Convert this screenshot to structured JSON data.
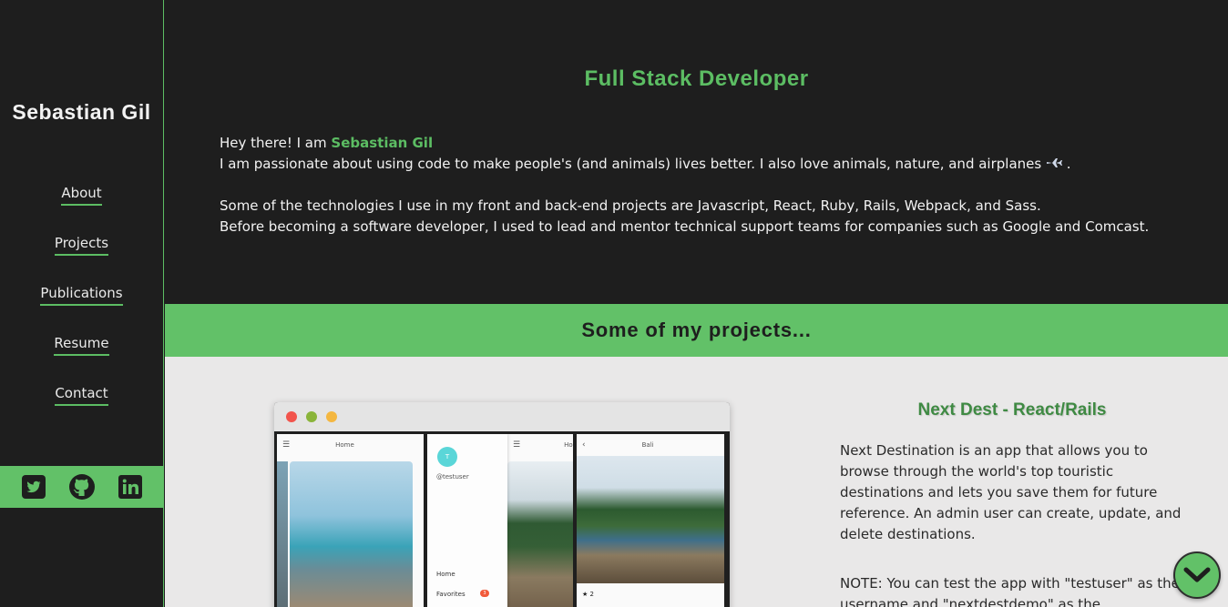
{
  "sidebar": {
    "name": "Sebastian Gil",
    "nav": [
      {
        "label": "About"
      },
      {
        "label": "Projects"
      },
      {
        "label": "Publications"
      },
      {
        "label": "Resume"
      },
      {
        "label": "Contact"
      }
    ],
    "social_icons": [
      "twitter-icon",
      "github-icon",
      "linkedin-icon"
    ]
  },
  "hero": {
    "title": "Full Stack Developer",
    "greeting_prefix": "Hey there! I am ",
    "greeting_name": "Sebastian Gil",
    "line2": "I am passionate about using code to make people's (and animals) lives better. I also love animals, nature, and airplanes",
    "line2_suffix": " .",
    "line3": "Some of the technologies I use in my front and back-end projects are Javascript, React, Ruby, Rails, Webpack, and Sass.",
    "line4": "Before becoming a software developer, I used to lead and mentor technical support teams for companies such as Google and Comcast."
  },
  "projects_section": {
    "heading": "Some of my projects...",
    "project": {
      "title": "Next Dest - React/Rails",
      "description": "Next Destination is an app that allows you to browse through the world's top touristic destinations and lets you save them for future reference. An admin user can create, update, and delete destinations.",
      "note": "NOTE: You can test the app with \"testuser\" as the username and \"nextdestdemo\" as the",
      "mockup": {
        "screen1_title": "Home",
        "screen2_avatar": "T",
        "screen2_user": "@testuser",
        "screen2_home": "Home",
        "screen2_favorites": "Favorites",
        "screen2_badge": "3",
        "screen2_title": "Ho",
        "screen3_title": "Bali",
        "screen3_rating": "★ 2"
      }
    }
  },
  "colors": {
    "accent": "#5cbd63",
    "band": "#62c168",
    "dark_bg": "#1e1e1e",
    "light_bg": "#e9e8e8",
    "project_title": "#3f8a43",
    "mock_dots": [
      "#f2544c",
      "#8ab43a",
      "#f4b740"
    ]
  },
  "scroll_button_icon": "chevron-down-icon"
}
